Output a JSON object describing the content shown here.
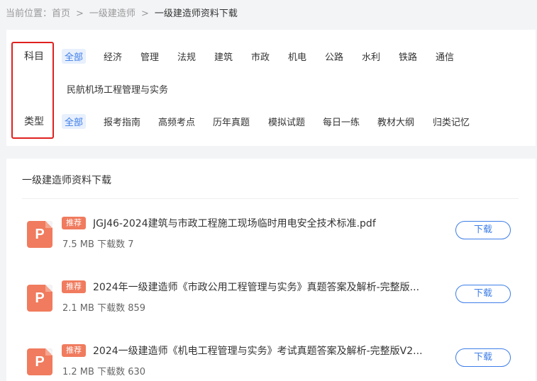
{
  "breadcrumb": {
    "prefix": "当前位置：首页",
    "sep": ">",
    "level2": "一级建造师",
    "current": "一级建造师资料下载"
  },
  "filters": {
    "subject_label": "科目",
    "type_label": "类型",
    "subjects": [
      "全部",
      "经济",
      "管理",
      "法规",
      "建筑",
      "市政",
      "机电",
      "公路",
      "水利",
      "铁路",
      "通信",
      "民航机场工程管理与实务"
    ],
    "types": [
      "全部",
      "报考指南",
      "高频考点",
      "历年真题",
      "模拟试题",
      "每日一练",
      "教材大纲",
      "归类记忆"
    ]
  },
  "list": {
    "title": "一级建造师资料下载",
    "download_label": "下载",
    "icon_letter": "P",
    "items": [
      {
        "badge": "推荐",
        "name": "JGJ46-2024建筑与市政工程施工现场临时用电安全技术标准.pdf",
        "size": "7.5 MB",
        "downloads": "下载数 7"
      },
      {
        "badge": "推荐",
        "name": "2024年一级建造师《市政公用工程管理与实务》真题答案及解析-完整版...",
        "size": "2.1 MB",
        "downloads": "下载数 859"
      },
      {
        "badge": "推荐",
        "name": "2024一级建造师《机电工程管理与实务》考试真题答案及解析-完整版V2...",
        "size": "1.2 MB",
        "downloads": "下载数 630"
      }
    ]
  },
  "colors": {
    "accent": "#3d7de8",
    "badge": "#f07b5e",
    "highlight_box": "#e02020"
  }
}
